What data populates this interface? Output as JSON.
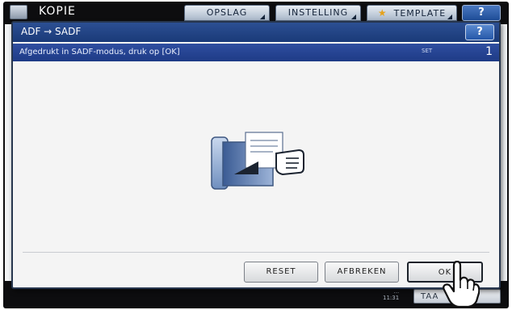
{
  "app": {
    "title": "KOPIE",
    "icon": "copy-icon"
  },
  "top_tabs": [
    {
      "label": "OPSLAG"
    },
    {
      "label": "INSTELLING"
    },
    {
      "label": "TEMPLATE",
      "icon": "star-icon"
    }
  ],
  "help_label": "?",
  "dialog": {
    "title": "ADF → SADF",
    "help_label": "?",
    "message": "Afgedrukt in SADF-modus, druk op [OK]",
    "set_label": "SET",
    "set_count": "1",
    "buttons": {
      "reset": "RESET",
      "abort": "AFBREKEN",
      "ok": "OK"
    },
    "illustration": "sadf-feed-icon"
  },
  "status": {
    "time_line1": "...",
    "time_line2": "11:31"
  },
  "task_button": "TAA",
  "colors": {
    "title_bar": "#1a3a78",
    "message_bar": "#1e3b86",
    "frame": "#0d0d0f",
    "star": "#e5a21c"
  }
}
